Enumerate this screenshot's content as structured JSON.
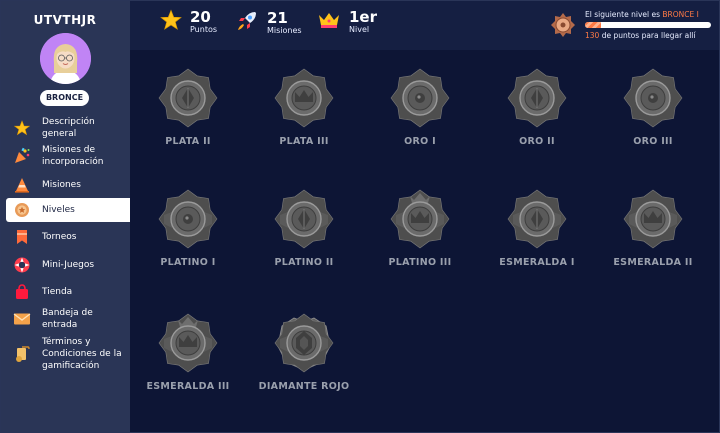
{
  "user": {
    "name": "UTVTHJR",
    "level_label": "BRONCE"
  },
  "nav": [
    {
      "label": "Descripción general",
      "icon": "star-icon"
    },
    {
      "label": "Misiones de incorporación",
      "icon": "confetti-icon"
    },
    {
      "label": "Misiones",
      "icon": "cone-icon"
    },
    {
      "label": "Niveles",
      "icon": "medal-icon",
      "active": true
    },
    {
      "label": "Torneos",
      "icon": "banner-icon"
    },
    {
      "label": "Mini-Juegos",
      "icon": "lifebuoy-icon"
    },
    {
      "label": "Tienda",
      "icon": "shopping-bag-icon"
    },
    {
      "label": "Bandeja de entrada",
      "icon": "envelope-icon"
    },
    {
      "label": "Términos y Condiciones de la gamificación",
      "icon": "scroll-icon"
    }
  ],
  "stats": {
    "points": {
      "value": "20",
      "label": "Puntos"
    },
    "missions": {
      "value": "21",
      "label": "Misiones"
    },
    "level": {
      "value": "1er",
      "label": "Nivel"
    }
  },
  "next_level": {
    "prefix": "El siguiente nivel es",
    "name": "BRONCE I",
    "points_needed": "130",
    "suffix": "de puntos para llegar allí",
    "progress": 0.13
  },
  "levels": [
    {
      "name": "PLATA II",
      "emblem": "diamond"
    },
    {
      "name": "PLATA III",
      "emblem": "crown"
    },
    {
      "name": "ORO I",
      "emblem": "circle"
    },
    {
      "name": "ORO II",
      "emblem": "diamond"
    },
    {
      "name": "ORO III",
      "emblem": "circle"
    },
    {
      "name": "PLATINO I",
      "emblem": "circle"
    },
    {
      "name": "PLATINO II",
      "emblem": "diamond"
    },
    {
      "name": "PLATINO III",
      "emblem": "crown"
    },
    {
      "name": "ESMERALDA I",
      "emblem": "diamond"
    },
    {
      "name": "ESMERALDA II",
      "emblem": "crown"
    },
    {
      "name": "ESMERALDA III",
      "emblem": "crown"
    },
    {
      "name": "DIAMANTE ROJO",
      "emblem": "gem"
    }
  ],
  "colors": {
    "sidebar": "#2a3556",
    "background": "#0d1535",
    "topbar": "#151f42",
    "accent": "#ff7a45",
    "locked_badge": "#6b6b6b",
    "label_gray": "#9aa0ad"
  }
}
